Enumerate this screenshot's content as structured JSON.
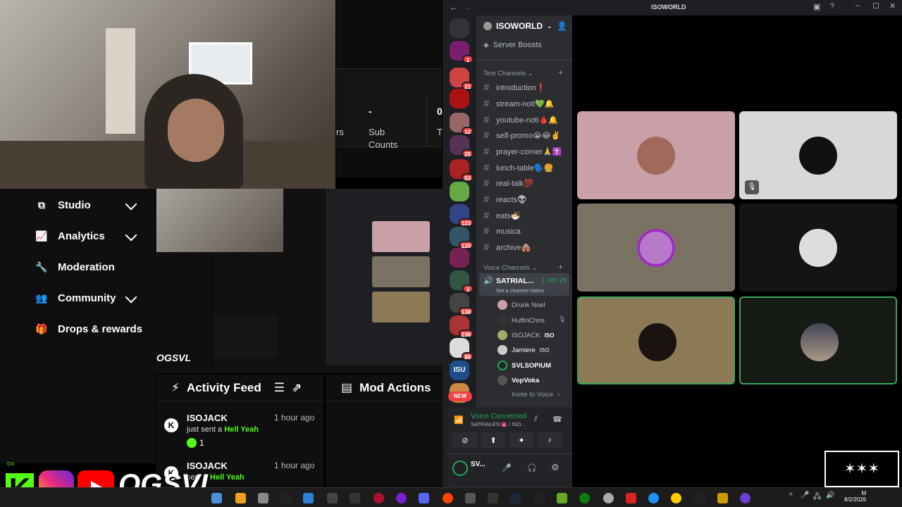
{
  "sidebar": {
    "items": [
      {
        "label": "Studio",
        "icon": "studio-icon",
        "chevron": true
      },
      {
        "label": "Analytics",
        "icon": "analytics-icon",
        "chevron": true
      },
      {
        "label": "Moderation",
        "icon": "wrench-icon",
        "chevron": false
      },
      {
        "label": "Community",
        "icon": "community-icon",
        "chevron": true
      },
      {
        "label": "Drops & rewards",
        "icon": "drops-icon",
        "chevron": false
      }
    ]
  },
  "stats": {
    "value": "-",
    "label1": "Sub",
    "label2": "Counts",
    "partial_left": "rs",
    "partial_right_value": "0",
    "partial_right_label": "T"
  },
  "activity": {
    "title": "Activity Feed",
    "items": [
      {
        "name": "ISOJACK",
        "time": "1 hour ago",
        "desc_prefix": "just sent a",
        "desc_item": "Hell Yeah",
        "count": "1"
      },
      {
        "name": "ISOJACK",
        "time": "1 hour ago",
        "desc_prefix": "sent a",
        "desc_item": "Hell Yeah"
      }
    ]
  },
  "mod_actions": {
    "title": "Mod Actions"
  },
  "brand": {
    "handle": "OGSVL",
    "gx": "GX"
  },
  "discord": {
    "window_title": "ISOWORLD",
    "server_name": "ISOWORLD",
    "server_boosts": "Server Boosts",
    "text_category": "Text Channels",
    "text_channels": [
      "introduction❗",
      "stream-noti💚🔔",
      "youtube-noti🩸🔔",
      "self-promo😭😂✌️",
      "prayer-corner🙏✝️",
      "lunch-table🗣️🍔",
      "real-talk💯",
      "reacts👽",
      "eats🍜",
      "musica",
      "archive🛖"
    ],
    "voice_category": "Voice Channels",
    "voice_channel": {
      "name": "SATRIAL...",
      "timer": "1:49:28",
      "status": "Set a channel status"
    },
    "voice_users": [
      {
        "name": "Drunk Noel",
        "tag": ""
      },
      {
        "name": "HuffinChris",
        "tag": ""
      },
      {
        "name": "ISOJACK",
        "tag": "ISO"
      },
      {
        "name": "Jamiere",
        "tag": "ISO"
      },
      {
        "name": "SVLSOPIUM",
        "tag": ""
      },
      {
        "name": "VopVoka",
        "tag": ""
      }
    ],
    "invite_to_voice": "Invite to Voice",
    "voice_connected": "Voice Connected",
    "voice_connected_sub": "SATRIALES!👅 / ISO...",
    "user_short": "SV...",
    "guild_badges": [
      "1",
      "21",
      "12",
      "25",
      "53",
      "123",
      "120",
      "3",
      "138",
      "236",
      "86"
    ],
    "new_label": "NEW",
    "iso_label": "ISU"
  },
  "clock": {
    "time": "M",
    "date": "8/2/2026"
  },
  "colors": {
    "kick_green": "#53fc18",
    "discord_bg": "#1e1f22",
    "channel_bg": "#2b2d31",
    "voice_green": "#23a55a"
  }
}
